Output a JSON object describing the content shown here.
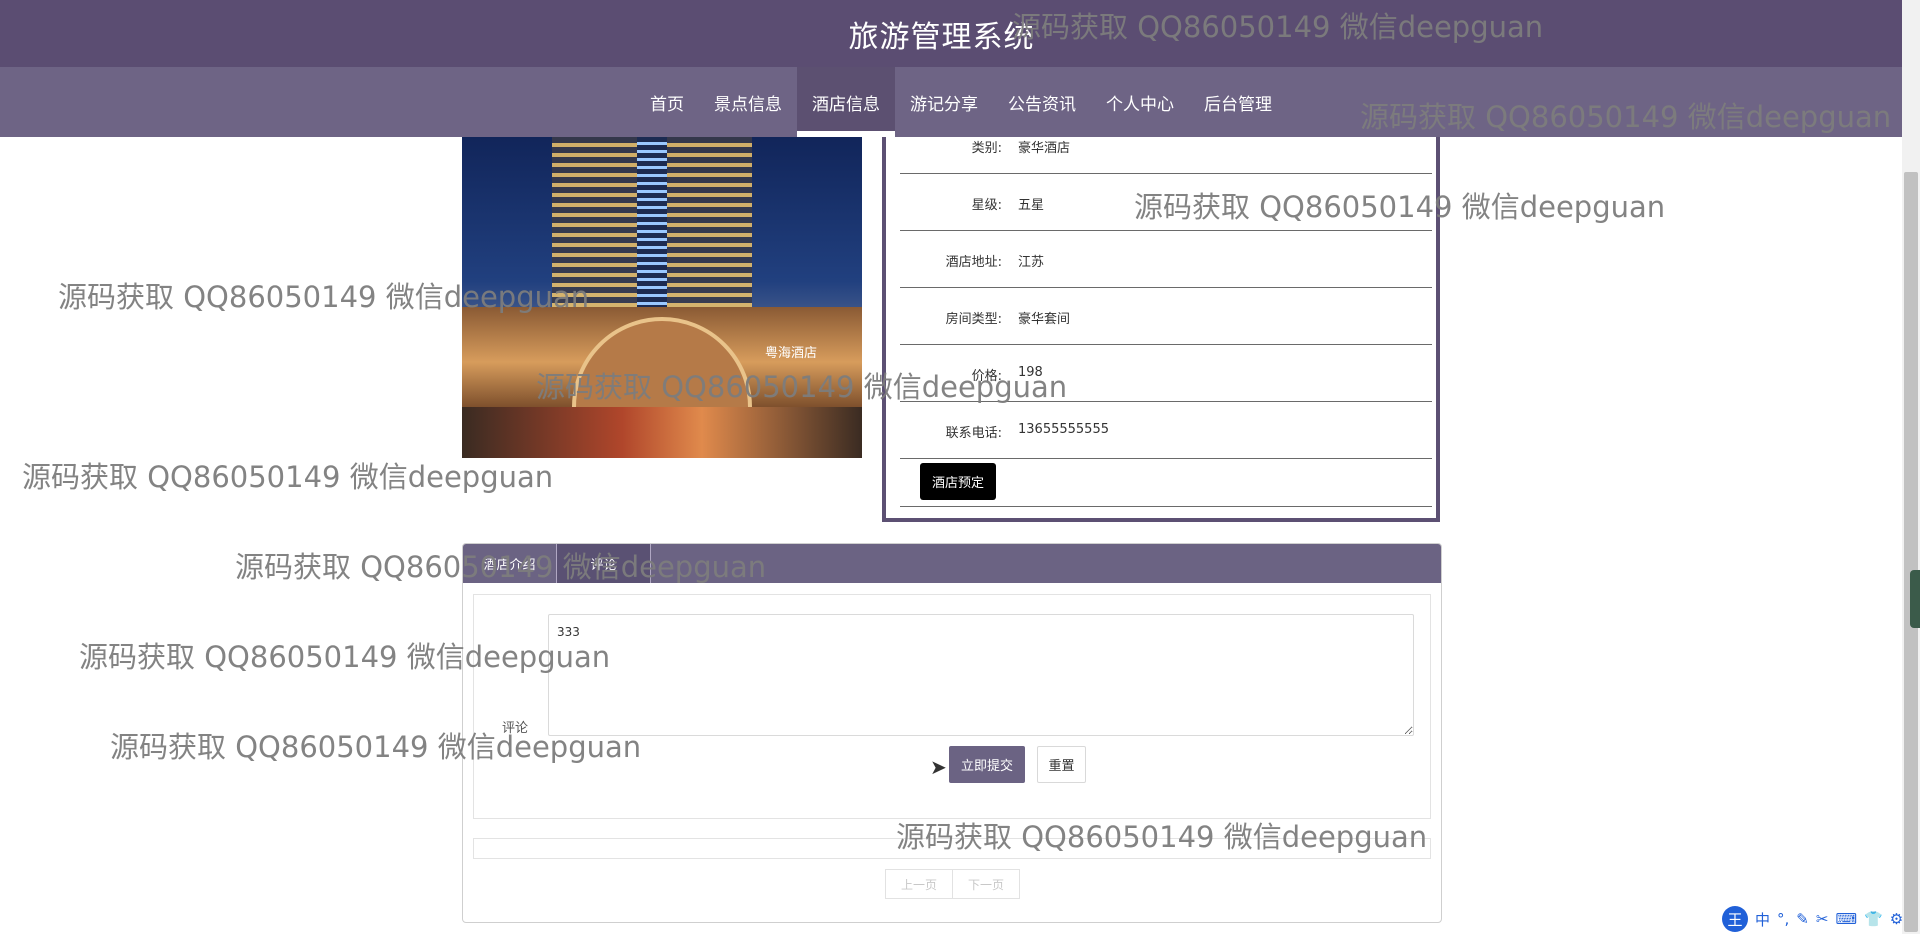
{
  "header": {
    "title": "旅游管理系统",
    "nav": [
      {
        "label": "首页",
        "active": false
      },
      {
        "label": "景点信息",
        "active": false
      },
      {
        "label": "酒店信息",
        "active": true
      },
      {
        "label": "游记分享",
        "active": false
      },
      {
        "label": "公告资讯",
        "active": false
      },
      {
        "label": "个人中心",
        "active": false
      },
      {
        "label": "后台管理",
        "active": false
      }
    ]
  },
  "hotel": {
    "photo_sign": "粤海酒店",
    "fields": [
      {
        "label": "类别:",
        "value": "豪华酒店"
      },
      {
        "label": "星级:",
        "value": "五星"
      },
      {
        "label": "酒店地址:",
        "value": "江苏"
      },
      {
        "label": "房间类型:",
        "value": "豪华套间"
      },
      {
        "label": "价格:",
        "value": "198"
      },
      {
        "label": "联系电话:",
        "value": "13655555555"
      }
    ],
    "book_button": "酒店预定"
  },
  "tabs": [
    {
      "label": "酒店介绍",
      "active": false
    },
    {
      "label": "评论",
      "active": true
    }
  ],
  "comment": {
    "label": "评论",
    "value": "333",
    "submit": "立即提交",
    "reset": "重置"
  },
  "pager": {
    "prev": "上一页",
    "next": "下一页"
  },
  "watermark": "源码获取 QQ86050149 微信deepguan",
  "ime": {
    "logo": "王",
    "glyphs": [
      "中",
      "°,",
      "✎",
      "✂",
      "⌨",
      "👕",
      "⚙"
    ]
  },
  "colors": {
    "header_dark": "#5b4d72",
    "header_nav": "#6e6485",
    "accent": "#6b6383",
    "book_button": "#000000"
  }
}
